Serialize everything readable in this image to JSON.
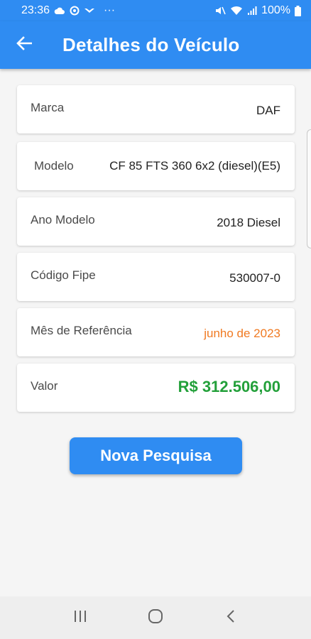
{
  "status_bar": {
    "time": "23:36",
    "extra": "···",
    "battery": "100%"
  },
  "app_bar": {
    "title": "Detalhes do Veículo"
  },
  "details": [
    {
      "label": "Marca",
      "value": "DAF"
    },
    {
      "label": "Modelo",
      "value": "CF 85 FTS 360 6x2 (diesel)(E5)"
    },
    {
      "label": "Ano Modelo",
      "value": "2018 Diesel"
    },
    {
      "label": "Código Fipe",
      "value": "530007-0"
    },
    {
      "label": "Mês de Referência",
      "value": "junho de 2023"
    },
    {
      "label": "Valor",
      "value": "R$ 312.506,00"
    }
  ],
  "button": {
    "new_search_label": "Nova Pesquisa"
  },
  "colors": {
    "primary": "#2f8cf2",
    "reference_month": "#f07a22",
    "price": "#23a03a"
  },
  "icons": {
    "back": "arrow-left-icon",
    "nav_recents": "recents-icon",
    "nav_home": "home-icon",
    "nav_back": "chevron-left-icon"
  }
}
